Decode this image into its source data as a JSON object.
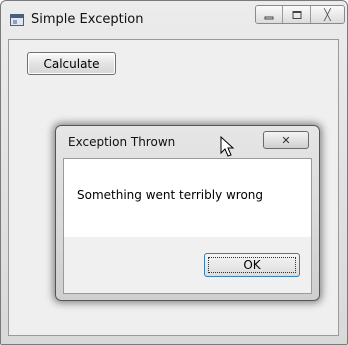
{
  "window": {
    "title": "Simple Exception",
    "icon": "window-app-icon",
    "caption_buttons": {
      "minimize": "minimize-icon",
      "maximize": "maximize-icon",
      "close": "close-icon",
      "close_glyph": "╳"
    }
  },
  "main": {
    "calculate_label": "Calculate"
  },
  "dialog": {
    "title": "Exception Thrown",
    "close_glyph": "✕",
    "message": "Something went terribly wrong",
    "ok_label": "OK"
  }
}
